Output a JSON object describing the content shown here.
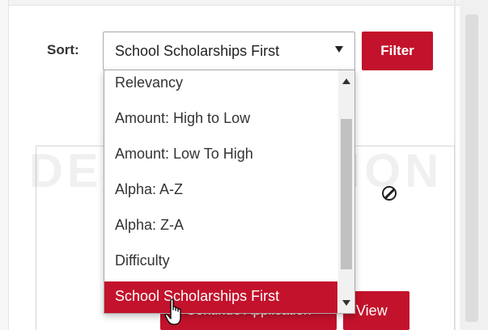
{
  "sort": {
    "label": "Sort:",
    "selected_value": "School Scholarships First",
    "filter_label": "Filter"
  },
  "dropdown": {
    "options": [
      "Relevancy",
      "Amount: High to Low",
      "Amount: Low To High",
      "Alpha: A-Z",
      "Alpha: Z-A",
      "Difficulty",
      "School Scholarships First"
    ],
    "selected_index": 6
  },
  "watermark": "DEMO VERSION",
  "card": {
    "continue_label": "Continue Application",
    "view_label": "View"
  },
  "colors": {
    "accent": "#c3122b",
    "selected_option_bg": "#c3122b"
  },
  "icons": {
    "ban": "ban-icon",
    "cursor": "hand-pointer-cursor"
  }
}
